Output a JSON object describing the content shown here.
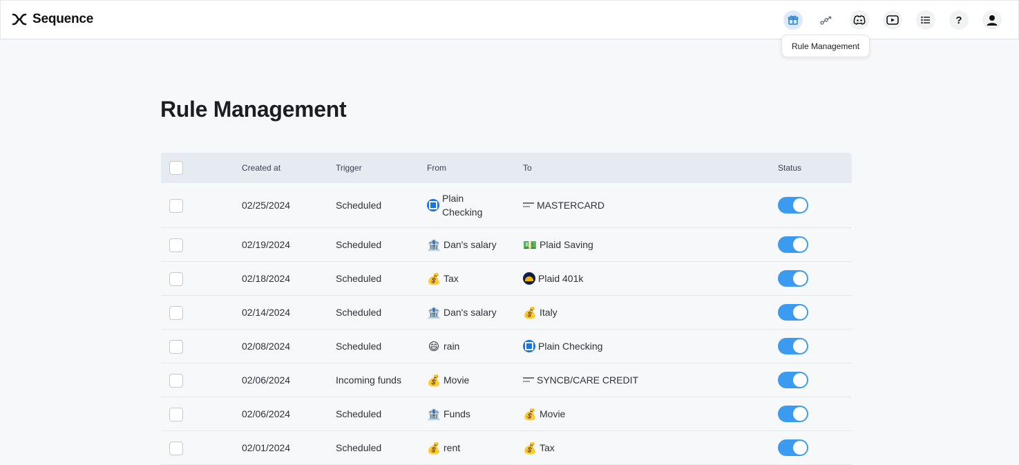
{
  "app": {
    "name": "Sequence"
  },
  "nav": {
    "icons": [
      "gift-icon",
      "rules-icon",
      "discord-icon",
      "youtube-icon",
      "list-icon",
      "help-icon",
      "user-icon"
    ],
    "help_glyph": "?",
    "tooltip": "Rule Management"
  },
  "page": {
    "title": "Rule Management"
  },
  "table": {
    "headers": {
      "created": "Created at",
      "trigger": "Trigger",
      "from": "From",
      "to": "To",
      "status": "Status"
    },
    "rows": [
      {
        "created": "02/25/2024",
        "trigger": "Scheduled",
        "from": {
          "icon": "bank-logo-icon",
          "label": "Plain Checking"
        },
        "to": {
          "icon": "credit-card-icon",
          "label": "MASTERCARD"
        },
        "status": true
      },
      {
        "created": "02/19/2024",
        "trigger": "Scheduled",
        "from": {
          "icon": "bank-building-icon",
          "label": "Dan's salary"
        },
        "to": {
          "icon": "cash-icon",
          "label": "Plaid Saving"
        },
        "status": true
      },
      {
        "created": "02/18/2024",
        "trigger": "Scheduled",
        "from": {
          "icon": "money-bag-icon",
          "label": "Tax"
        },
        "to": {
          "icon": "retirement-logo-icon",
          "label": "Plaid 401k"
        },
        "status": true
      },
      {
        "created": "02/14/2024",
        "trigger": "Scheduled",
        "from": {
          "icon": "bank-building-icon",
          "label": "Dan's salary"
        },
        "to": {
          "icon": "money-bag-icon",
          "label": "Italy"
        },
        "status": true
      },
      {
        "created": "02/08/2024",
        "trigger": "Scheduled",
        "from": {
          "icon": "smile-emoji-icon",
          "label": "rain"
        },
        "to": {
          "icon": "bank-logo-icon",
          "label": "Plain Checking"
        },
        "status": true
      },
      {
        "created": "02/06/2024",
        "trigger": "Incoming funds",
        "from": {
          "icon": "money-bag-icon",
          "label": "Movie"
        },
        "to": {
          "icon": "credit-card-icon",
          "label": "SYNCB/CARE CREDIT"
        },
        "status": true
      },
      {
        "created": "02/06/2024",
        "trigger": "Scheduled",
        "from": {
          "icon": "bank-building-icon",
          "label": "Funds"
        },
        "to": {
          "icon": "money-bag-icon",
          "label": "Movie"
        },
        "status": true
      },
      {
        "created": "02/01/2024",
        "trigger": "Scheduled",
        "from": {
          "icon": "money-bag-icon",
          "label": "rent"
        },
        "to": {
          "icon": "money-bag-icon",
          "label": "Tax"
        },
        "status": true
      }
    ]
  },
  "colors": {
    "accent": "#3b9bf0",
    "header_bg": "#e6ebf2",
    "page_bg": "#f7f8fa"
  }
}
